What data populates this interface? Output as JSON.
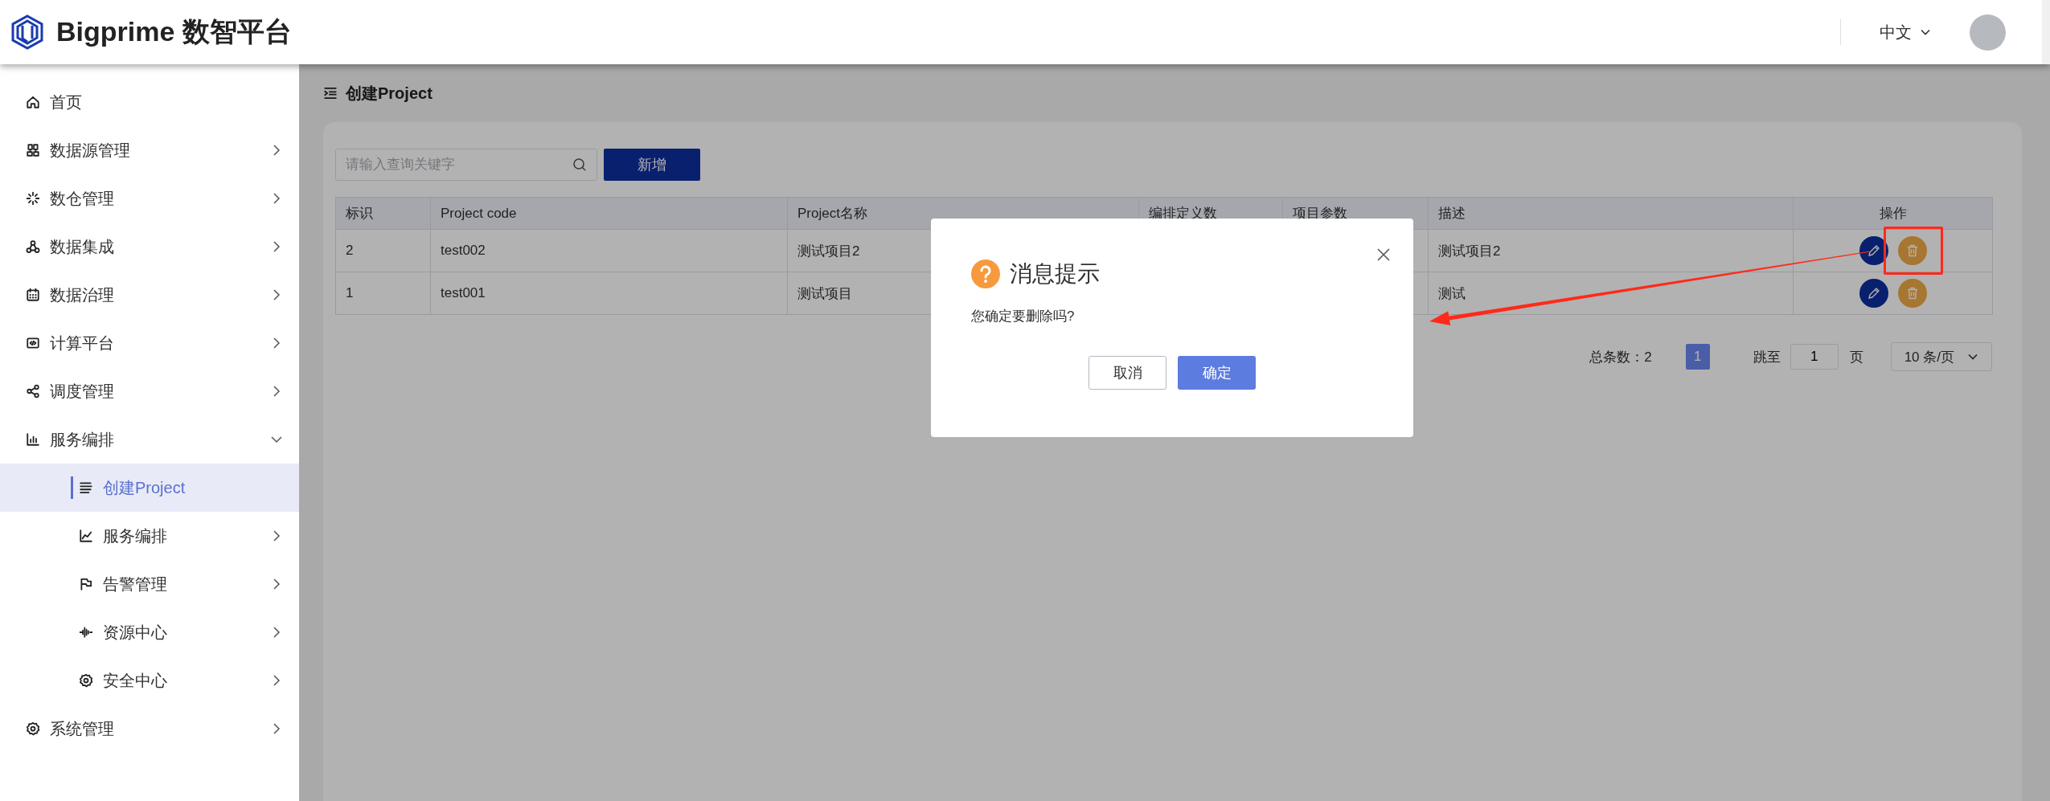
{
  "header": {
    "title": "Bigprime 数智平台",
    "language": "中文"
  },
  "sidebar": {
    "items": [
      {
        "label": "首页",
        "kind": "leaf",
        "selected": false
      },
      {
        "label": "数据源管理",
        "kind": "menu",
        "expanded": false,
        "selected": false
      },
      {
        "label": "数仓管理",
        "kind": "menu",
        "expanded": false,
        "selected": false
      },
      {
        "label": "数据集成",
        "kind": "menu",
        "expanded": false,
        "selected": false
      },
      {
        "label": "数据治理",
        "kind": "menu",
        "expanded": false,
        "selected": false
      },
      {
        "label": "计算平台",
        "kind": "menu",
        "expanded": false,
        "selected": false
      },
      {
        "label": "调度管理",
        "kind": "menu",
        "expanded": false,
        "selected": false
      },
      {
        "label": "服务编排",
        "kind": "menu",
        "expanded": true,
        "selected": false,
        "children": [
          {
            "label": "创建Project",
            "kind": "leaf",
            "selected": true
          },
          {
            "label": "服务编排",
            "kind": "menu",
            "expanded": false,
            "selected": false
          },
          {
            "label": "告警管理",
            "kind": "menu",
            "expanded": false,
            "selected": false
          },
          {
            "label": "资源中心",
            "kind": "menu",
            "expanded": false,
            "selected": false
          },
          {
            "label": "安全中心",
            "kind": "menu",
            "expanded": false,
            "selected": false
          }
        ]
      },
      {
        "label": "系统管理",
        "kind": "menu",
        "expanded": false,
        "selected": false
      }
    ]
  },
  "breadcrumb": "创建Project",
  "search": {
    "placeholder": "请输入查询关键字"
  },
  "add_button": "新增",
  "table": {
    "columns": [
      "标识",
      "Project code",
      "Project名称",
      "编排定义数",
      "项目参数",
      "描述",
      "操作"
    ],
    "rows": [
      {
        "id": "2",
        "code": "test002",
        "name": "测试项目2",
        "description": "测试项目2",
        "highlighted": true
      },
      {
        "id": "1",
        "code": "test001",
        "name": "测试项目",
        "description": "测试",
        "highlighted": false
      }
    ]
  },
  "pagination": {
    "total": "总条数：2",
    "pages": [
      {
        "label": "1",
        "selected": true
      }
    ],
    "jump_label": "跳至",
    "jump_value": "1",
    "page_unit": "页",
    "page_size": "10 条/页"
  },
  "dialog": {
    "title": "消息提示",
    "message": "您确定要删除吗?",
    "buttons": [
      {
        "label": "取消",
        "kind": "default"
      },
      {
        "label": "确定",
        "kind": "primary"
      }
    ]
  }
}
